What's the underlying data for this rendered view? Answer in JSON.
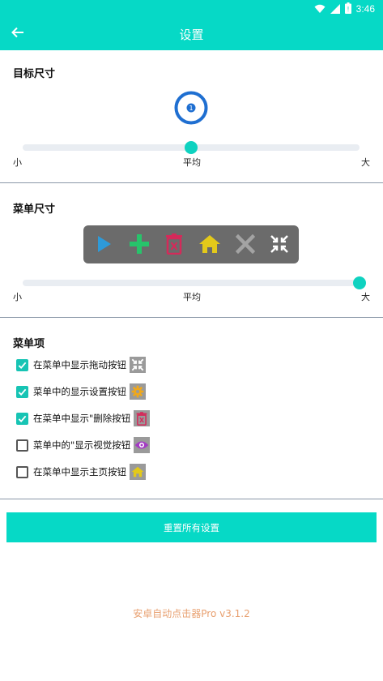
{
  "status_bar": {
    "time": "3:46",
    "icons": [
      "wifi-icon",
      "signal-icon",
      "battery-icon"
    ]
  },
  "app_bar": {
    "title": "设置",
    "back_icon": "arrow-left-icon"
  },
  "target_size": {
    "title": "目标尺寸",
    "slider": {
      "min_label": "小",
      "mid_label": "平均",
      "max_label": "大",
      "value_fraction": 0.5
    },
    "preview_icon": "target-icon"
  },
  "menu_size": {
    "title": "菜单尺寸",
    "slider": {
      "min_label": "小",
      "mid_label": "平均",
      "max_label": "大",
      "value_fraction": 1.0
    },
    "preview_items": [
      "play-icon",
      "plus-icon",
      "trash-icon",
      "home-icon",
      "close-icon",
      "collapse-icon"
    ]
  },
  "menu_items": {
    "title": "菜单项",
    "items": [
      {
        "label": "在菜单中显示拖动按钮",
        "checked": true,
        "icon": "collapse-icon"
      },
      {
        "label": "菜单中的显示设置按钮",
        "checked": true,
        "icon": "gear-icon"
      },
      {
        "label": "在菜单中显示\"删除按钮",
        "checked": true,
        "icon": "trash-icon"
      },
      {
        "label": "菜单中的\"显示视觉按钮",
        "checked": false,
        "icon": "eye-icon"
      },
      {
        "label": "在菜单中显示主页按钮",
        "checked": false,
        "icon": "home-icon"
      }
    ]
  },
  "reset_button": {
    "label": "重置所有设置"
  },
  "footer": {
    "version": "安卓自动点击器Pro v3.1.2"
  },
  "colors": {
    "accent": "#06d9c6",
    "thumb": "#0fd2c0",
    "checkbox": "#17c4b4",
    "version_text": "#e8a070",
    "target_ring": "#1f6fd1"
  }
}
